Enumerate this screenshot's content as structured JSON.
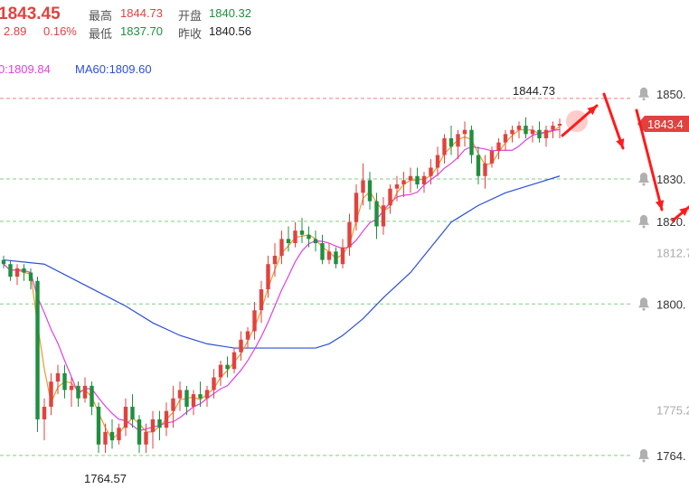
{
  "header": {
    "price": "1843.45",
    "change": "2.89",
    "change_pct": "0.16%",
    "high_label": "最高",
    "high_value": "1844.73",
    "low_label": "最低",
    "low_value": "1837.70",
    "open_label": "开盘",
    "open_value": "1840.32",
    "prev_close_label": "昨收",
    "prev_close_value": "1840.56"
  },
  "ma_legend": {
    "ma_left": "0:1809.84",
    "ma60": "MA60:1809.60"
  },
  "colors": {
    "up": "#e0433f",
    "down": "#1f8f3f",
    "ma_orange": "#f0972c",
    "ma_magenta": "#e040e0",
    "ma60_blue": "#2b4fd8",
    "grid_green": "#7fd27f",
    "grid_red": "#f08080",
    "arrow_red": "#ff1a1a"
  },
  "chart_data": {
    "type": "candlestick",
    "y_range": [
      1762,
      1854
    ],
    "price_levels": [
      "1850.",
      "1830.",
      "1820.",
      "1812.7",
      "1800.",
      "1775.2",
      "1764."
    ],
    "current_price_tag": "1843.4",
    "max_annotation": "1844.73",
    "min_annotation": "1764.57",
    "grid_lines": [
      1849.5,
      1830.3,
      1820.2,
      1800.5,
      1764.4
    ],
    "candles": [
      [
        1811,
        1812,
        1809,
        1810
      ],
      [
        1810,
        1811,
        1806,
        1807
      ],
      [
        1807,
        1810,
        1805,
        1809
      ],
      [
        1809,
        1810,
        1806,
        1808
      ],
      [
        1808,
        1809,
        1804,
        1806
      ],
      [
        1806,
        1807,
        1770,
        1773
      ],
      [
        1773,
        1778,
        1768,
        1776
      ],
      [
        1776,
        1784,
        1774,
        1782
      ],
      [
        1782,
        1786,
        1779,
        1784
      ],
      [
        1784,
        1786,
        1778,
        1780
      ],
      [
        1780,
        1783,
        1776,
        1781
      ],
      [
        1781,
        1782,
        1776,
        1778
      ],
      [
        1778,
        1783,
        1777,
        1781
      ],
      [
        1781,
        1782,
        1774,
        1776
      ],
      [
        1776,
        1777,
        1765,
        1767
      ],
      [
        1767,
        1772,
        1765,
        1770
      ],
      [
        1770,
        1773,
        1766,
        1768
      ],
      [
        1768,
        1772,
        1767,
        1771
      ],
      [
        1771,
        1778,
        1769,
        1776
      ],
      [
        1776,
        1779,
        1771,
        1773
      ],
      [
        1773,
        1774,
        1765,
        1767
      ],
      [
        1767,
        1772,
        1765,
        1770
      ],
      [
        1770,
        1775,
        1766,
        1773
      ],
      [
        1773,
        1775,
        1768,
        1771
      ],
      [
        1771,
        1777,
        1769,
        1775
      ],
      [
        1775,
        1781,
        1771,
        1778
      ],
      [
        1778,
        1782,
        1775,
        1780
      ],
      [
        1780,
        1781,
        1774,
        1776
      ],
      [
        1776,
        1780,
        1774,
        1779
      ],
      [
        1779,
        1782,
        1776,
        1778
      ],
      [
        1778,
        1781,
        1776,
        1780
      ],
      [
        1780,
        1785,
        1778,
        1783
      ],
      [
        1783,
        1787,
        1781,
        1786
      ],
      [
        1786,
        1788,
        1783,
        1785
      ],
      [
        1785,
        1790,
        1784,
        1789
      ],
      [
        1789,
        1794,
        1787,
        1792
      ],
      [
        1792,
        1795,
        1790,
        1794
      ],
      [
        1794,
        1801,
        1792,
        1799
      ],
      [
        1799,
        1806,
        1796,
        1804
      ],
      [
        1804,
        1812,
        1802,
        1810
      ],
      [
        1810,
        1815,
        1807,
        1812
      ],
      [
        1812,
        1818,
        1810,
        1816
      ],
      [
        1816,
        1819,
        1813,
        1815
      ],
      [
        1815,
        1820,
        1814,
        1818
      ],
      [
        1818,
        1821,
        1815,
        1817
      ],
      [
        1817,
        1819,
        1814,
        1816
      ],
      [
        1816,
        1818,
        1813,
        1815
      ],
      [
        1815,
        1817,
        1810,
        1811
      ],
      [
        1811,
        1815,
        1810,
        1813
      ],
      [
        1813,
        1814,
        1809,
        1810
      ],
      [
        1810,
        1816,
        1809,
        1814
      ],
      [
        1814,
        1822,
        1812,
        1820
      ],
      [
        1820,
        1829,
        1818,
        1827
      ],
      [
        1827,
        1834,
        1824,
        1830
      ],
      [
        1830,
        1832,
        1823,
        1825
      ],
      [
        1825,
        1827,
        1816,
        1819
      ],
      [
        1819,
        1826,
        1817,
        1824
      ],
      [
        1824,
        1829,
        1822,
        1828
      ],
      [
        1828,
        1831,
        1825,
        1829
      ],
      [
        1829,
        1832,
        1826,
        1830
      ],
      [
        1830,
        1833,
        1827,
        1831
      ],
      [
        1831,
        1833,
        1828,
        1829
      ],
      [
        1829,
        1832,
        1827,
        1831
      ],
      [
        1831,
        1835,
        1829,
        1833
      ],
      [
        1833,
        1838,
        1831,
        1836
      ],
      [
        1836,
        1841,
        1834,
        1840
      ],
      [
        1840,
        1843,
        1836,
        1838
      ],
      [
        1838,
        1842,
        1835,
        1841
      ],
      [
        1841,
        1844,
        1838,
        1842
      ],
      [
        1842,
        1843,
        1834,
        1836
      ],
      [
        1836,
        1838,
        1829,
        1831
      ],
      [
        1831,
        1836,
        1828,
        1834
      ],
      [
        1834,
        1838,
        1833,
        1837
      ],
      [
        1837,
        1840,
        1835,
        1839
      ],
      [
        1839,
        1842,
        1837,
        1841
      ],
      [
        1841,
        1843,
        1839,
        1842
      ],
      [
        1842,
        1844,
        1840,
        1843
      ],
      [
        1843,
        1845,
        1840,
        1841
      ],
      [
        1841,
        1843,
        1839,
        1842
      ],
      [
        1842,
        1844,
        1839,
        1840
      ],
      [
        1840,
        1843,
        1838,
        1842
      ],
      [
        1842,
        1844,
        1840,
        1843
      ],
      [
        1843,
        1844.7,
        1840,
        1843.45
      ]
    ],
    "ma60_points": [
      [
        1811,
        0
      ],
      [
        1810,
        6
      ],
      [
        1805,
        12
      ],
      [
        1800,
        18
      ],
      [
        1796,
        22
      ],
      [
        1793,
        26
      ],
      [
        1791,
        30
      ],
      [
        1790,
        34
      ],
      [
        1790,
        40
      ],
      [
        1790,
        46
      ],
      [
        1791,
        48
      ],
      [
        1793,
        50
      ],
      [
        1797,
        53
      ],
      [
        1802,
        56
      ],
      [
        1808,
        60
      ],
      [
        1814,
        63
      ],
      [
        1820,
        66
      ],
      [
        1824,
        70
      ],
      [
        1827,
        74
      ],
      [
        1829,
        78
      ],
      [
        1831,
        82
      ]
    ]
  }
}
